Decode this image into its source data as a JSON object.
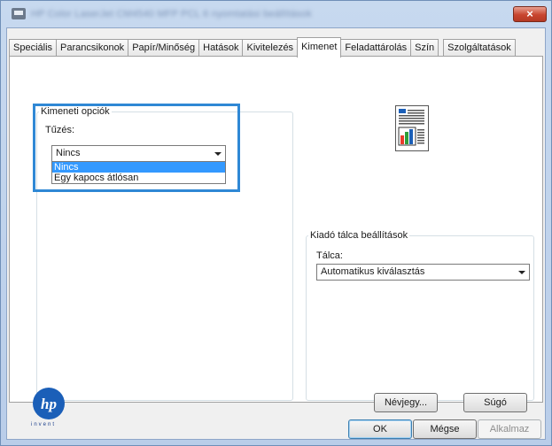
{
  "window": {
    "title": "HP Color LaserJet CM4540 MFP PCL 6 nyomtatási beállítások",
    "close_label": "×"
  },
  "tabs": [
    {
      "label": "Speciális"
    },
    {
      "label": "Parancsikonok"
    },
    {
      "label": "Papír/Minőség"
    },
    {
      "label": "Hatások"
    },
    {
      "label": "Kivitelezés"
    },
    {
      "label": "Kimenet",
      "active": true
    },
    {
      "label": "Feladattárolás"
    },
    {
      "label": "Szín"
    },
    {
      "label": "Szolgáltatások"
    }
  ],
  "output_options": {
    "group_title": "Kimeneti opciók",
    "stapling_label": "Tűzés:",
    "stapling_value": "Nincs",
    "stapling_options": [
      "Nincs",
      "Egy kapocs átlósan"
    ]
  },
  "output_bin": {
    "group_title": "Kiadó tálca beállítások",
    "bin_label": "Tálca:",
    "bin_value": "Automatikus kiválasztás"
  },
  "footer": {
    "logo_text": "hp",
    "invent_text": "invent",
    "about_label": "Névjegy...",
    "help_label": "Súgó",
    "ok_label": "OK",
    "cancel_label": "Mégse",
    "apply_label": "Alkalmaz"
  },
  "colors": {
    "highlight": "#2f88d5",
    "selection": "#3399ff",
    "hp_blue": "#1b5fb8"
  }
}
